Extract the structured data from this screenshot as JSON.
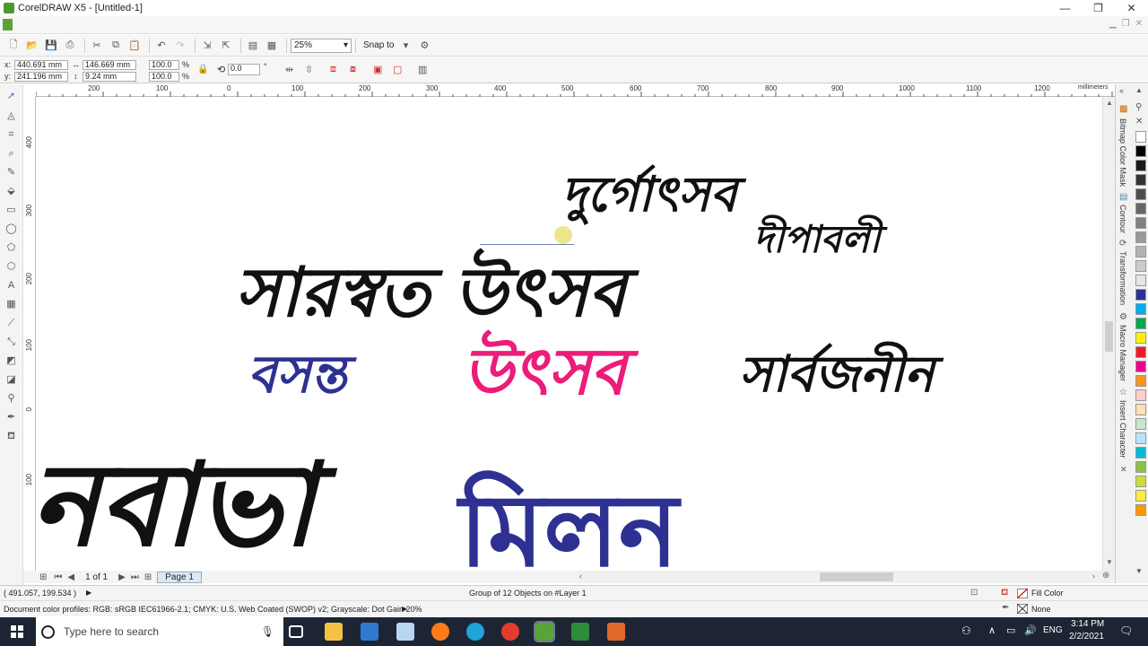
{
  "window": {
    "title": "CorelDRAW X5 - [Untitled-1]",
    "minimize": "—",
    "maximize": "❐",
    "close": "✕"
  },
  "toolbar": {
    "zoom": "25%",
    "snap_to": "Snap to"
  },
  "propbar": {
    "x_label": "x:",
    "x_value": "440.691 mm",
    "y_label": "y:",
    "y_value": "241.196 mm",
    "w_value": "146.669 mm",
    "h_value": "9.24 mm",
    "scale_w": "100.0",
    "scale_h": "100.0",
    "pct": "%",
    "angle": "0.0",
    "deg": "°"
  },
  "ruler": {
    "unit": "millimeters",
    "ticks": [
      "200",
      "100",
      "0",
      "100",
      "200",
      "300",
      "400",
      "500",
      "600",
      "700",
      "800",
      "900",
      "1000",
      "1100",
      "1200"
    ],
    "vticks": [
      "400",
      "300",
      "200",
      "100",
      "0",
      "100"
    ]
  },
  "canvas": {
    "line1": "দুর্গোৎসব",
    "line1b": "দীপাবলী",
    "line2": "সারস্বত উৎসব",
    "line3a": "বসন্ত",
    "line3b": "উৎসব",
    "line3c": "সার্বজনীন",
    "line4a": "নবাভা",
    "line4b": "মিলন"
  },
  "pagenav": {
    "page_count": "1 of 1",
    "page_tab": "Page 1"
  },
  "dockers": [
    "Bitmap Color Mask",
    "Contour",
    "Transformation",
    "Macro Manager",
    "Insert Character"
  ],
  "palette": [
    "#ffffff",
    "#000000",
    "#1a1a1a",
    "#333333",
    "#4d4d4d",
    "#666666",
    "#808080",
    "#999999",
    "#b3b3b3",
    "#cccccc",
    "#e6e6e6",
    "#2e3192",
    "#00aeef",
    "#00a651",
    "#fff200",
    "#ed1c24",
    "#ec008c",
    "#f7941d",
    "#ffcccc",
    "#ffe0b2",
    "#c8e6c9",
    "#b3e5fc",
    "#00bcd4",
    "#8bc34a",
    "#cddc39",
    "#ffeb3b",
    "#ff9800"
  ],
  "status": {
    "coords": "( 491.057, 199.534 )",
    "selection": "Group of 12 Objects on #Layer 1",
    "fill": "Fill Color",
    "outline": "None",
    "profiles": "Document color profiles: RGB: sRGB IEC61966-2.1; CMYK: U.S. Web Coated (SWOP) v2; Grayscale: Dot Gain 20%"
  },
  "taskbar": {
    "search_placeholder": "Type here to search",
    "time": "3:14 PM",
    "date": "2/2/2021",
    "lang": "ENG"
  }
}
